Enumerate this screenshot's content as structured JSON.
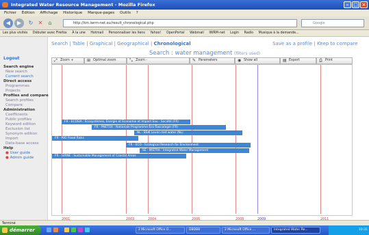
{
  "window": {
    "title": "Integrated Water Resource Management - Mozilla Firefox"
  },
  "menu": [
    "Fichier",
    "Édition",
    "Affichage",
    "Historique",
    "Marque-pages",
    "Outils",
    "?"
  ],
  "url": "http://km.iwrm-net.eu/result_chronological.php",
  "search_placeholder": "Google",
  "bookmarks": [
    "Les plus visités",
    "Débuter avec Firefox",
    "À la une",
    "Hotmail",
    "Personnaliser les liens",
    "Yahoo!",
    "OpenPortal",
    "Webmail",
    "IWRM-net",
    "Login",
    "Radio",
    "Musique à la demande..."
  ],
  "sidebar": {
    "logout": "Logout",
    "search_engine": "Search engine",
    "new_search": "New search",
    "current_search": "Current search",
    "direct_access": "Direct access",
    "programmes": "Programmes",
    "projects": "Projects",
    "profiles": "Profiles and compare",
    "search_profiles": "Search profiles",
    "compare": "Compare",
    "administration": "Administration",
    "coefficients": "Coefficients",
    "public_profiles": "Public profiles",
    "keyword_edition": "Keyword edition",
    "exclusion_list": "Exclusion list",
    "synonym_edition": "Synonym edition",
    "import": "Import",
    "database_access": "Data-base access",
    "help": "Help",
    "user_guide": "User guide",
    "admin_guide": "Admin guide"
  },
  "topnav": {
    "search": "Search",
    "table": "Table",
    "graphical": "Graphical",
    "geographical": "Geographical",
    "chronological": "Chronological",
    "sep": "|"
  },
  "rightnav": {
    "save_profile": "Save as a profile",
    "sep": "|",
    "keep_compare": "Keep to compare"
  },
  "heading": {
    "text": "Search : water management",
    "filters": "(filters used)"
  },
  "toolbar": {
    "zoom_plus": "Zoom +",
    "optimal_zoom": "Optimal zoom",
    "zoom_minus": "Zoom -",
    "parameters": "Parameters",
    "show_all": "Show all",
    "export": "Export",
    "print": "Print"
  },
  "timeline": {
    "years": [
      "2001",
      "2003",
      "2004",
      "2006",
      "2008",
      "2009",
      "2011"
    ],
    "bars": [
      {
        "label": "FR - ECOSIA : Écosystèmes, Énergie et Économie et Impact Eau - Société (FR)"
      },
      {
        "label": "FR - PNETOX : Nationale Programme Éco-Toxicologie (FR)"
      },
      {
        "label": "NL - BSIK Leven met water (NL)"
      },
      {
        "label": "FR - RIO Flood Risks"
      },
      {
        "label": "FR - ECO - Ecological Research for Environment"
      },
      {
        "label": "SE - MISTRA : Integrated Water Management"
      },
      {
        "label": "FR - GIRNE : Sustainable Management of Coastal Areas"
      }
    ]
  },
  "status": "Terminé",
  "taskbar": {
    "start": "démarrer",
    "items": [
      "2 Microsoft Office O...",
      "DBDBB",
      "2 Microsoft Office ...",
      "Integrated Water Re..."
    ],
    "clock": "10:31"
  }
}
